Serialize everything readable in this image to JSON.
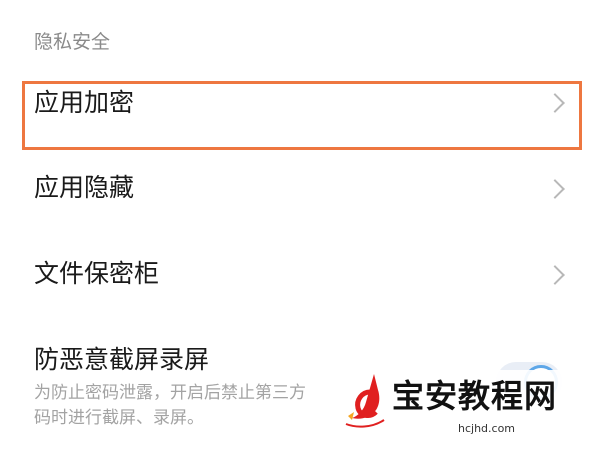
{
  "section": {
    "title": "隐私安全"
  },
  "items": [
    {
      "label": "应用加密"
    },
    {
      "label": "应用隐藏"
    },
    {
      "label": "文件保密柜"
    },
    {
      "label": "防恶意截屏录屏",
      "description_line1": "为防止密码泄露，开启后禁止第三方",
      "description_line2": "码时进行截屏、录屏。",
      "toggle_on": true
    }
  ],
  "watermark": {
    "title": "宝安教程网",
    "url": "hcjhd.com"
  },
  "colors": {
    "highlight": "#ee7740",
    "toggle_accent": "#5ea7e8",
    "logo_red": "#e02020"
  }
}
